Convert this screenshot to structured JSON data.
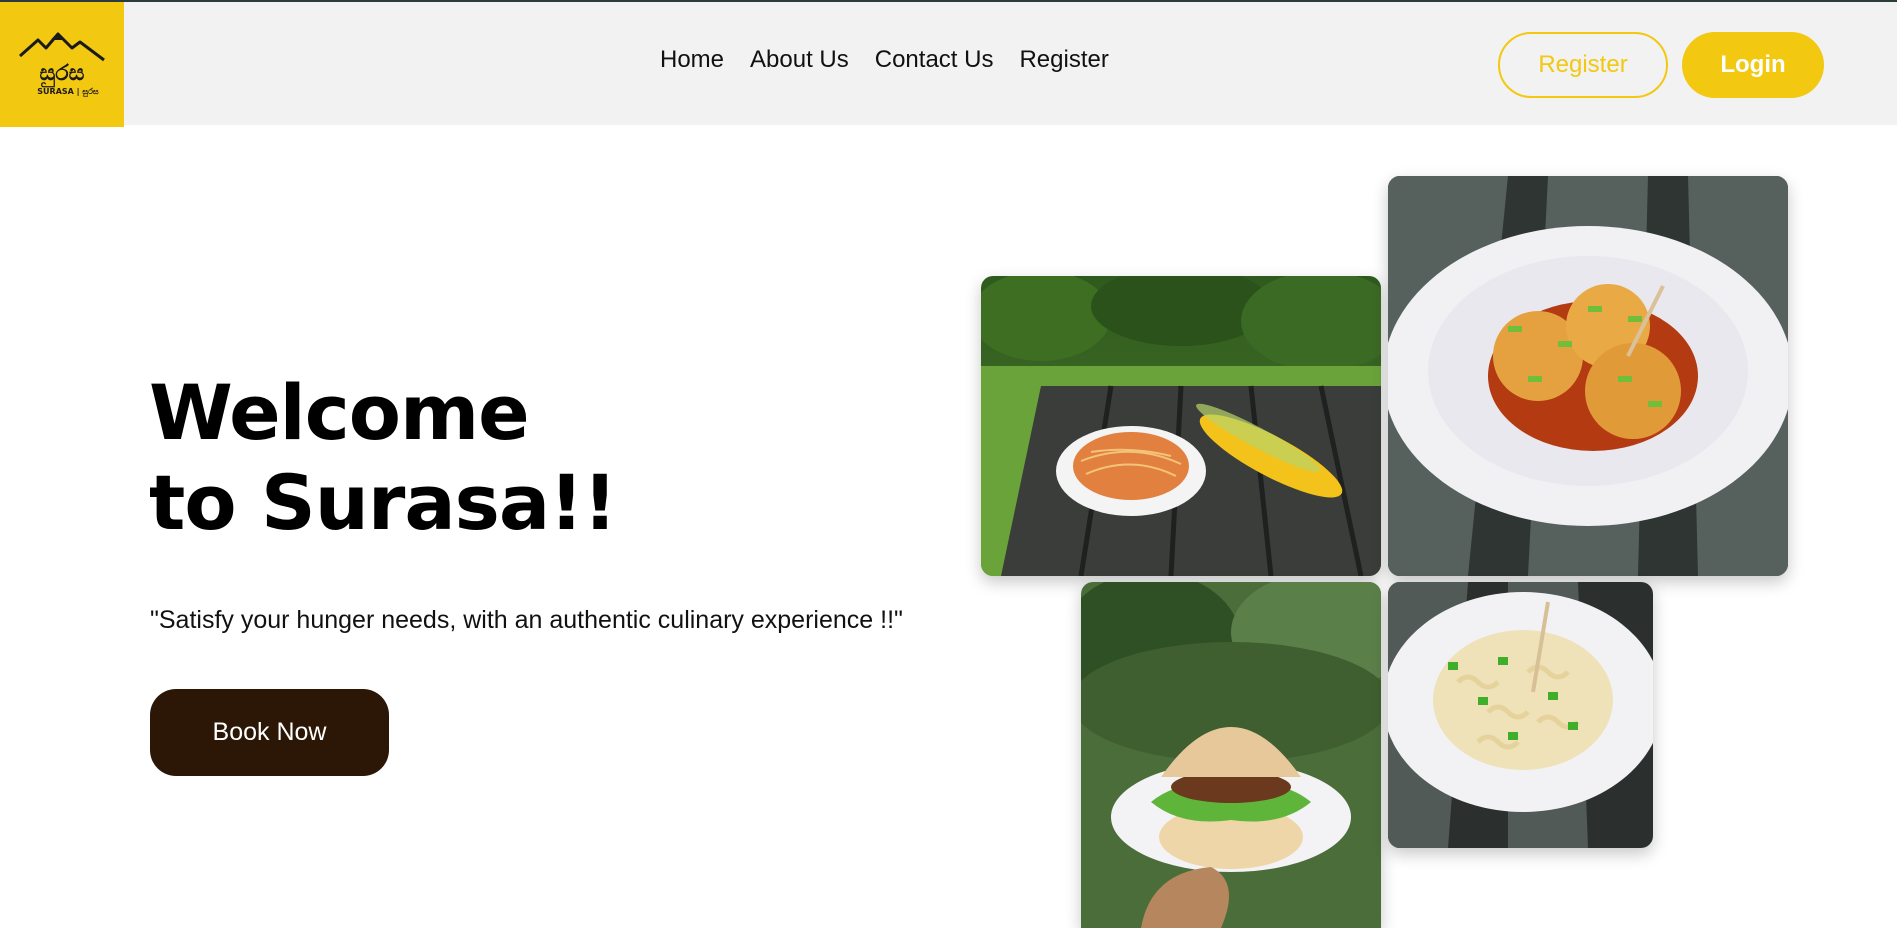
{
  "header": {
    "logo": {
      "name": "surasa-logo",
      "text": "SURASA | සුරස"
    },
    "nav": [
      "Home",
      "About Us",
      "Contact Us",
      "Register"
    ],
    "register_button": "Register",
    "login_button": "Login"
  },
  "hero": {
    "title_line1": "Welcome",
    "title_line2": "to Surasa!!",
    "tagline": "\"Satisfy your hunger needs, with an authentic culinary experience !!\"",
    "cta": "Book Now"
  },
  "gallery": [
    {
      "name": "noodles-and-corn-photo"
    },
    {
      "name": "fried-balls-in-sauce-photo"
    },
    {
      "name": "burger-photo"
    },
    {
      "name": "pasta-photo"
    }
  ],
  "colors": {
    "brand_yellow": "#f2c811",
    "header_bg": "#f2f2f2",
    "cta_brown": "#2c1707"
  }
}
